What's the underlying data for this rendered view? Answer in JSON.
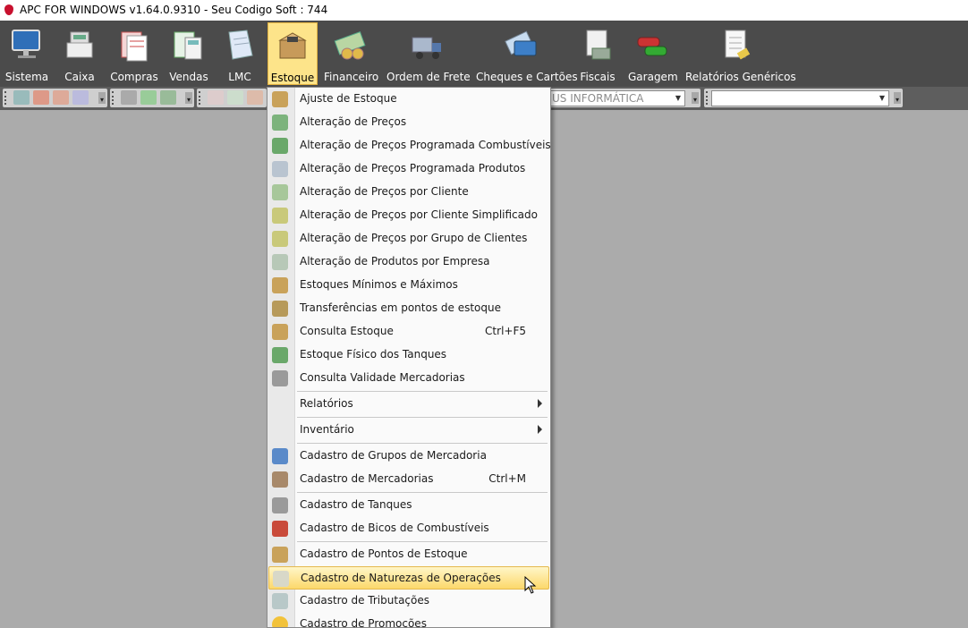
{
  "window": {
    "title": "APC FOR WINDOWS v1.64.0.9310 - Seu Codigo Soft : 744"
  },
  "ribbon": {
    "items": [
      {
        "label": "Sistema",
        "icon": "monitor-icon"
      },
      {
        "label": "Caixa",
        "icon": "cash-register-icon"
      },
      {
        "label": "Compras",
        "icon": "forms-icon"
      },
      {
        "label": "Vendas",
        "icon": "calculator-icon"
      },
      {
        "label": "LMC",
        "icon": "document-icon"
      },
      {
        "label": "Estoque",
        "icon": "box-icon",
        "active": true
      },
      {
        "label": "Financeiro",
        "icon": "money-icon"
      },
      {
        "label": "Ordem de Frete",
        "icon": "truck-icon"
      },
      {
        "label": "Cheques e Cartões",
        "icon": "cards-icon"
      },
      {
        "label": "Fiscais",
        "icon": "fiscal-icon"
      },
      {
        "label": "Garagem",
        "icon": "cars-icon"
      },
      {
        "label": "Relatórios Genéricos",
        "icon": "report-icon"
      }
    ]
  },
  "toolbar": {
    "company_combo": "US INFORMÁTICA",
    "second_combo": ""
  },
  "menu": {
    "items": [
      {
        "label": "Ajuste de Estoque"
      },
      {
        "label": "Alteração de Preços"
      },
      {
        "label": "Alteração de Preços Programada Combustíveis"
      },
      {
        "label": "Alteração de Preços Programada Produtos"
      },
      {
        "label": "Alteração de Preços por Cliente"
      },
      {
        "label": "Alteração de Preços por Cliente Simplificado"
      },
      {
        "label": "Alteração de Preços por Grupo de Clientes"
      },
      {
        "label": "Alteração de Produtos por Empresa"
      },
      {
        "label": "Estoques Mínimos e Máximos"
      },
      {
        "label": "Transferências em pontos de estoque"
      },
      {
        "label": "Consulta Estoque",
        "shortcut": "Ctrl+F5"
      },
      {
        "label": "Estoque Físico dos Tanques"
      },
      {
        "label": "Consulta Validade Mercadorias"
      },
      {
        "label": "Relatórios",
        "submenu": true
      },
      {
        "label": "Inventário",
        "submenu": true
      },
      {
        "label": "Cadastro de Grupos de Mercadoria"
      },
      {
        "label": "Cadastro de Mercadorias",
        "shortcut": "Ctrl+M"
      },
      {
        "label": "Cadastro de Tanques"
      },
      {
        "label": "Cadastro de Bicos de Combustíveis"
      },
      {
        "label": "Cadastro de Pontos de Estoque"
      },
      {
        "label": "Cadastro de Naturezas de Operações",
        "highlighted": true
      },
      {
        "label": "Cadastro de Tributações"
      },
      {
        "label": "Cadastro de Promoções"
      }
    ]
  },
  "colors": {
    "ribbon_bg": "#4b4b4b",
    "active_tab": "#fde48a",
    "highlight": "#fcd86b",
    "workspace": "#ababab"
  }
}
